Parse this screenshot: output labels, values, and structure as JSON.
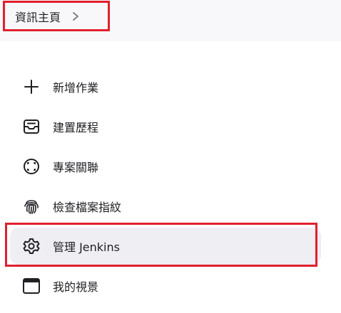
{
  "breadcrumb": {
    "label": "資訊主頁"
  },
  "sidebar": {
    "items": [
      {
        "label": "新增作業",
        "icon": "plus-icon"
      },
      {
        "label": "建置歷程",
        "icon": "inbox-tray-icon"
      },
      {
        "label": "專案關聯",
        "icon": "relation-icon"
      },
      {
        "label": "檢查檔案指紋",
        "icon": "fingerprint-icon"
      },
      {
        "label": "管理 Jenkins",
        "icon": "gear-icon",
        "active": true
      },
      {
        "label": "我的視景",
        "icon": "window-icon"
      }
    ]
  },
  "colors": {
    "highlight": "#e0202e",
    "active_bg": "#efeef3",
    "topbar_bg": "#f8f8fa"
  }
}
